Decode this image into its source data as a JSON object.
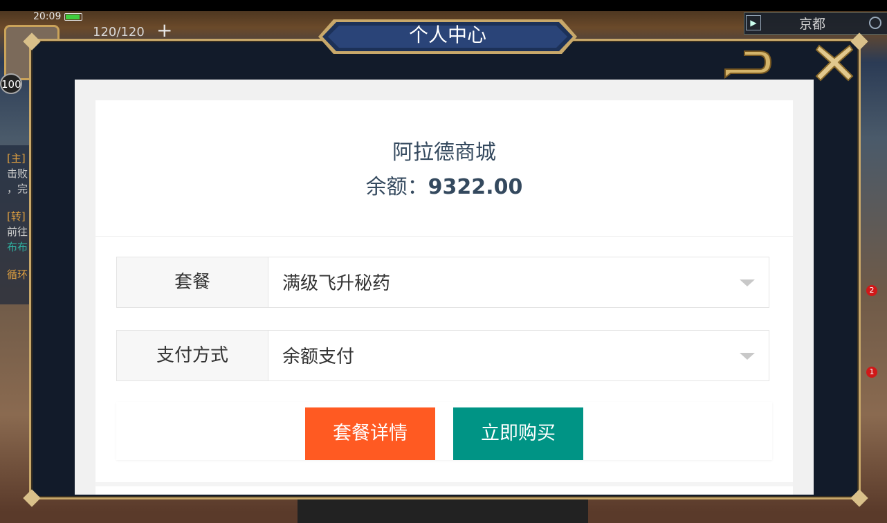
{
  "status_bar": {
    "time": "20:09",
    "battery_level": 0.9
  },
  "hud": {
    "energy": "120/120",
    "plus_icon": "+",
    "level": "100",
    "location": "京都",
    "quest_lines": [
      "[主]",
      "击败",
      "，完",
      "[转]",
      "前往",
      "布布",
      "循环"
    ],
    "badges": [
      "2",
      "1"
    ]
  },
  "modal": {
    "title": "个人中心",
    "back_icon": "back-arrow-icon",
    "close_icon": "close-x-icon",
    "frame_color": "#c8a86a",
    "panel_color": "#121b2a"
  },
  "store": {
    "name": "阿拉德商城",
    "balance_label": "余额：",
    "balance_value": "9322.00"
  },
  "form": {
    "package": {
      "label": "套餐",
      "value": "满级飞升秘药"
    },
    "payment": {
      "label": "支付方式",
      "value": "余额支付"
    }
  },
  "actions": {
    "details_label": "套餐详情",
    "details_color": "#ff5a22",
    "buy_label": "立即购买",
    "buy_color": "#009485"
  }
}
